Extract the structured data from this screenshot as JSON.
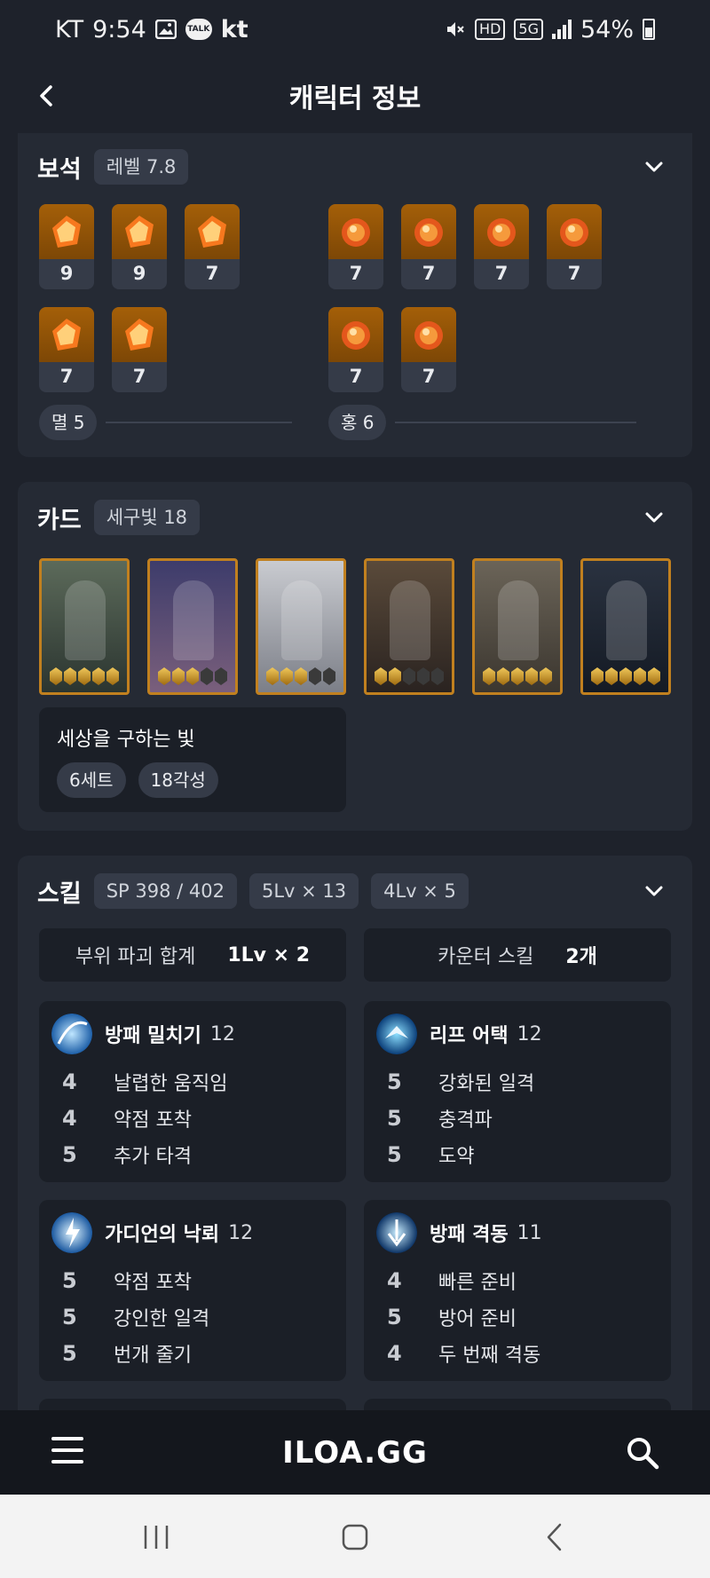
{
  "status_bar": {
    "carrier": "KT",
    "time": "9:54",
    "kt_logo": "kt",
    "talk_badge": "TALK",
    "hd_badge": "HD",
    "net_badge": "5G",
    "battery": "54%"
  },
  "header": {
    "title": "캐릭터 정보"
  },
  "gems": {
    "title": "보석",
    "level_chip": "레벨 7.8",
    "left_gems": [
      "9",
      "9",
      "7",
      "7",
      "7"
    ],
    "right_gems": [
      "7",
      "7",
      "7",
      "7",
      "7",
      "7"
    ],
    "left_group": "멸 5",
    "right_group": "홍 6",
    "colors": {
      "gem_bg": "#a45f08"
    }
  },
  "cards": {
    "title": "카드",
    "set_chip": "세구빛 18",
    "set_name": "세상을 구하는 빛",
    "set_count": "6세트",
    "awakening": "18각성",
    "items": [
      {
        "awakened": 5,
        "total": 5
      },
      {
        "awakened": 3,
        "total": 5
      },
      {
        "awakened": 3,
        "total": 5
      },
      {
        "awakened": 2,
        "total": 5
      },
      {
        "awakened": 5,
        "total": 5
      },
      {
        "awakened": 5,
        "total": 5
      }
    ]
  },
  "skills": {
    "title": "스킬",
    "chips": [
      "SP 398 / 402",
      "5Lv × 13",
      "4Lv × 5"
    ],
    "summary": [
      {
        "label": "부위 파괴 합계",
        "value": "1Lv × 2"
      },
      {
        "label": "카운터 스킬",
        "value": "2개"
      }
    ],
    "list": [
      {
        "name": "방패 밀치기",
        "level": "12",
        "tripods": [
          {
            "lvl": "4",
            "name": "날렵한 움직임"
          },
          {
            "lvl": "4",
            "name": "약점 포착"
          },
          {
            "lvl": "5",
            "name": "추가 타격"
          }
        ]
      },
      {
        "name": "리프 어택",
        "level": "12",
        "tripods": [
          {
            "lvl": "5",
            "name": "강화된 일격"
          },
          {
            "lvl": "5",
            "name": "충격파"
          },
          {
            "lvl": "5",
            "name": "도약"
          }
        ]
      },
      {
        "name": "가디언의 낙뢰",
        "level": "12",
        "tripods": [
          {
            "lvl": "5",
            "name": "약점 포착"
          },
          {
            "lvl": "5",
            "name": "강인한 일격"
          },
          {
            "lvl": "5",
            "name": "번개 줄기"
          }
        ]
      },
      {
        "name": "방패 격동",
        "level": "11",
        "tripods": [
          {
            "lvl": "4",
            "name": "빠른 준비"
          },
          {
            "lvl": "5",
            "name": "방어 준비"
          },
          {
            "lvl": "4",
            "name": "두 번째 격동"
          }
        ]
      }
    ]
  },
  "bottom_nav": {
    "brand": "ILOA.GG"
  }
}
